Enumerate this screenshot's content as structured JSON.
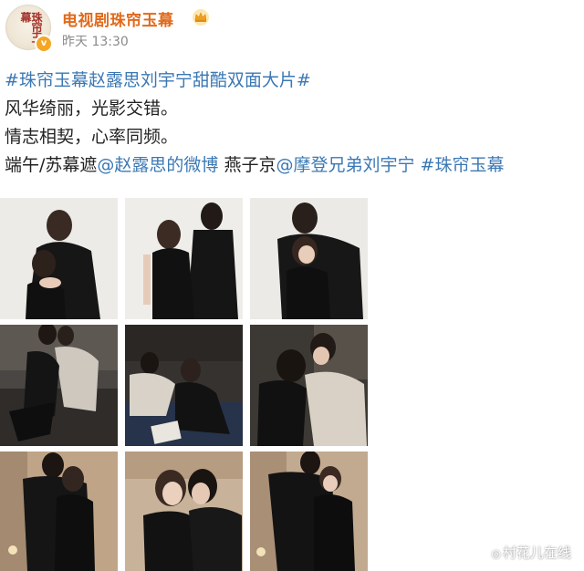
{
  "account": {
    "avatar_text": "珠帘玉幕",
    "name": "电视剧珠帘玉幕",
    "time": "昨天 13:30",
    "verified_mark": "v",
    "icons": {
      "avatar": "avatar-image",
      "badge": "verified-badge-icon",
      "crown": "crown-icon"
    }
  },
  "post": {
    "line1_tag": "#珠帘玉幕赵露思刘宇宁甜酷双面大片#",
    "line2": "风华绮丽，光影交错。",
    "line3": "情志相契，心率同频。",
    "line4_a": "端午/苏幕遮",
    "line4_mention1": "@赵露思的微博",
    "line4_b": " 燕子京",
    "line4_mention2": "@摩登兄弟刘宇宁",
    "line4_tag": " #珠帘玉幕"
  },
  "watermark": {
    "icon": "watermark-icon",
    "text": "村花儿在线"
  },
  "colors": {
    "name": "#e06a1b",
    "link": "#3b78b4",
    "text": "#222222",
    "time": "#8a8a8a"
  }
}
